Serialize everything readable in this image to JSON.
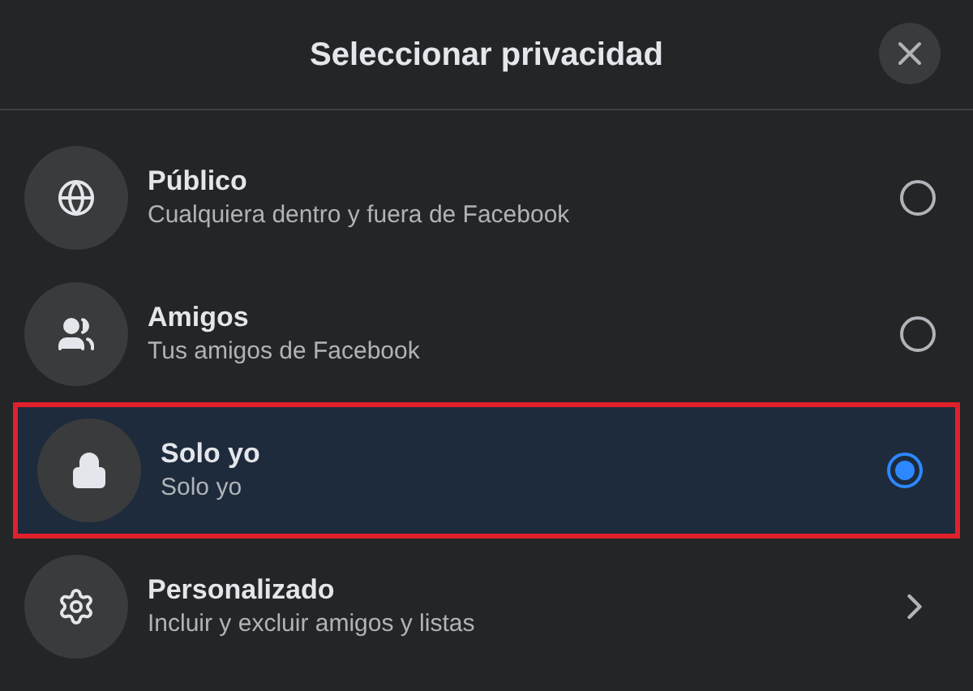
{
  "dialog": {
    "title": "Seleccionar privacidad"
  },
  "options": [
    {
      "kind": "radio",
      "title": "Público",
      "subtitle": "Cualquiera dentro y fuera de Facebook",
      "selected": false,
      "highlighted": false
    },
    {
      "kind": "radio",
      "title": "Amigos",
      "subtitle": "Tus amigos de Facebook",
      "selected": false,
      "highlighted": false
    },
    {
      "kind": "radio",
      "title": "Solo yo",
      "subtitle": "Solo yo",
      "selected": true,
      "highlighted": true
    },
    {
      "kind": "chevron",
      "title": "Personalizado",
      "subtitle": "Incluir y excluir amigos y listas",
      "selected": false,
      "highlighted": false
    }
  ]
}
